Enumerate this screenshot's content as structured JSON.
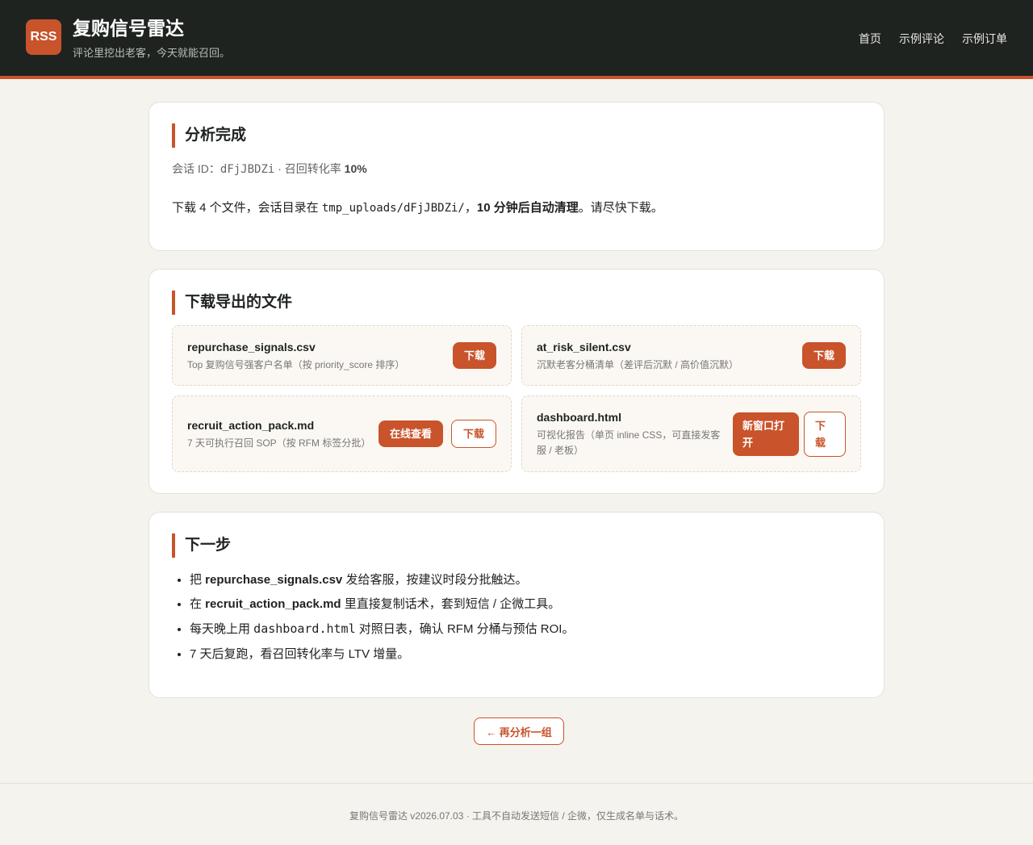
{
  "header": {
    "logo": "RSS",
    "title": "复购信号雷达",
    "subtitle": "评论里挖出老客，今天就能召回。",
    "nav": [
      "首页",
      "示例评论",
      "示例订单"
    ]
  },
  "summary": {
    "title": "分析完成",
    "session_label": "会话 ID：",
    "session_id": "dFjJBDZi",
    "rate_label": " · 召回转化率 ",
    "rate": "10%",
    "notice_a": "下载 4 个文件，会话目录在 ",
    "notice_dir": "tmp_uploads/dFjJBDZi/",
    "notice_b": "，",
    "notice_bold": "10 分钟后自动清理",
    "notice_c": "。请尽快下载。"
  },
  "downloads": {
    "title": "下载导出的文件",
    "files": [
      {
        "name": "repurchase_signals.csv",
        "desc": "Top 复购信号强客户名单（按 priority_score 排序）",
        "download": "下载"
      },
      {
        "name": "at_risk_silent.csv",
        "desc": "沉默老客分桶清单（差评后沉默 / 高价值沉默）",
        "download": "下载"
      },
      {
        "name": "recruit_action_pack.md",
        "desc": "7 天可执行召回 SOP（按 RFM 标签分批）",
        "view": "在线查看",
        "download": "下载"
      },
      {
        "name": "dashboard.html",
        "desc": "可视化报告（单页 inline CSS，可直接发客服 / 老板）",
        "open": "新窗口打开",
        "download": "下载"
      }
    ]
  },
  "next": {
    "title": "下一步",
    "steps": [
      {
        "a": "把 ",
        "b": "repurchase_signals.csv",
        "c": " 发给客服，按建议时段分批触达。"
      },
      {
        "a": "在 ",
        "b": "recruit_action_pack.md",
        "c": " 里直接复制话术，套到短信 / 企微工具。"
      },
      {
        "a": "每天晚上用 ",
        "m": "dashboard.html",
        "c": " 对照日表，确认 RFM 分桶与预估 ROI。"
      },
      {
        "a": "7 天后复跑，看召回转化率与 LTV 增量。"
      }
    ]
  },
  "again_button": "← 再分析一组",
  "footer": "复购信号雷达 v2026.07.03 · 工具不自动发送短信 / 企微，仅生成名单与话术。"
}
